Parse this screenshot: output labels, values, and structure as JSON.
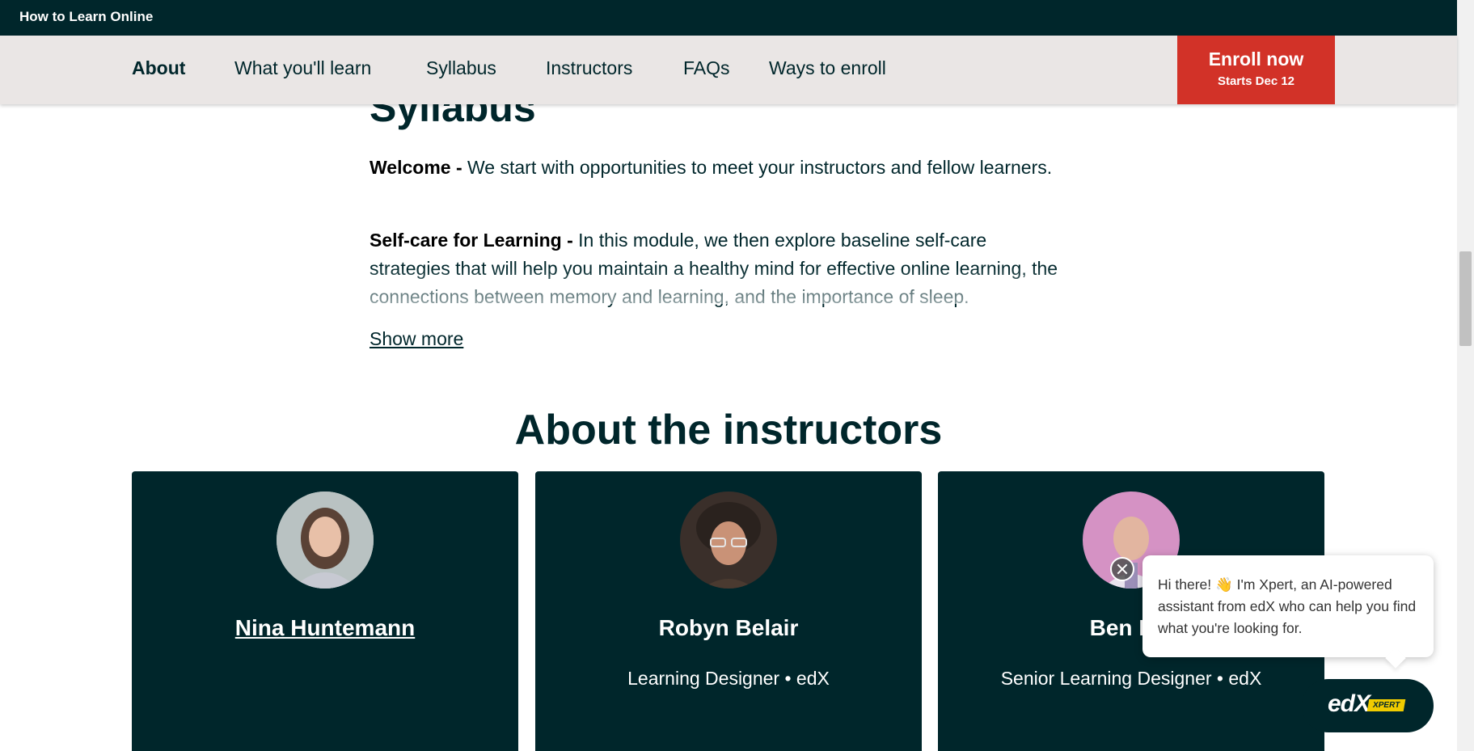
{
  "topbar": {
    "course_title": "How to Learn Online"
  },
  "nav": {
    "items": [
      {
        "label": "About",
        "active": true
      },
      {
        "label": "What you'll learn",
        "active": false
      },
      {
        "label": "Syllabus",
        "active": false
      },
      {
        "label": "Instructors",
        "active": false
      },
      {
        "label": "FAQs",
        "active": false
      },
      {
        "label": "Ways to enroll",
        "active": false
      }
    ],
    "enroll": {
      "label": "Enroll now",
      "sub": "Starts Dec 12",
      "color": "#d23228"
    }
  },
  "syllabus": {
    "heading": "Syllabus",
    "items": [
      {
        "title": "Welcome - ",
        "text": "We start with opportunities to meet your instructors and fellow learners."
      },
      {
        "title": "Self-care for Learning - ",
        "text": "In this module, we then explore baseline self-care strategies that will help you maintain a healthy mind for effective online learning, the connections between memory and learning, and the importance of sleep."
      }
    ],
    "show_more": "Show more"
  },
  "instructors": {
    "heading": "About the instructors",
    "cards": [
      {
        "name": "Nina Huntemann",
        "role": ""
      },
      {
        "name": "Robyn Belair",
        "role": "Learning Designer • edX"
      },
      {
        "name": "Ben Pis",
        "role": "Senior Learning Designer • edX"
      }
    ]
  },
  "chat": {
    "message": "Hi there! 👋 I'm Xpert, an AI-powered assistant from edX who can help you find what you're looking for.",
    "brand": "edX",
    "badge": "XPERT"
  },
  "colors": {
    "dark": "#00262b",
    "nav_bg": "#eae6e5",
    "enroll": "#d23228",
    "accent": "#f0cc00"
  }
}
